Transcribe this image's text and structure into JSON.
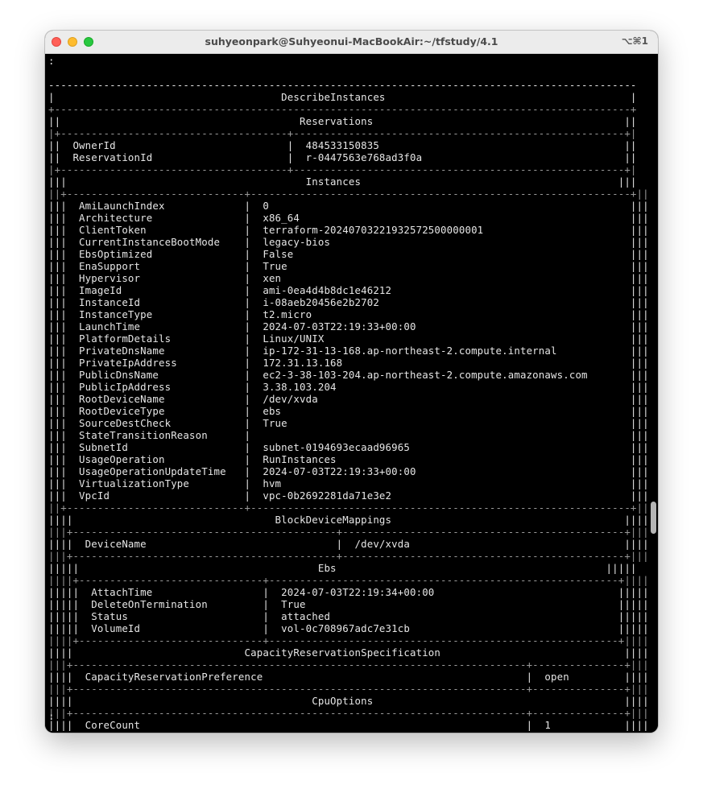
{
  "window": {
    "title": "suhyeonpark@Suhyeonui-MacBookAir:~/tfstudy/4.1",
    "shortcut": "⌥⌘1"
  },
  "terminal": {
    "lines": [
      ":",
      "",
      "------------------------------------------------------------------------------------------------",
      "|                                     DescribeInstances                                        |",
      "+----------------------------------------------------------------------------------------------+",
      "||                                       Reservations                                         ||",
      "|+-------------------------------------+------------------------------------------------------+|",
      "||  OwnerId                            |  484533150835                                        ||",
      "||  ReservationId                      |  r-0447563e768ad3f0a                                 ||",
      "|+-------------------------------------+------------------------------------------------------+|",
      "|||                                       Instances                                          |||",
      "||+-----------------------------+--------------------------------------------------------------+||",
      "|||  AmiLaunchIndex             |  0                                                           |||",
      "|||  Architecture               |  x86_64                                                      |||",
      "|||  ClientToken                |  terraform-20240703221932572500000001                        |||",
      "|||  CurrentInstanceBootMode    |  legacy-bios                                                 |||",
      "|||  EbsOptimized               |  False                                                       |||",
      "|||  EnaSupport                 |  True                                                        |||",
      "|||  Hypervisor                 |  xen                                                         |||",
      "|||  ImageId                    |  ami-0ea4d4b8dc1e46212                                       |||",
      "|||  InstanceId                 |  i-08aeb20456e2b2702                                         |||",
      "|||  InstanceType               |  t2.micro                                                    |||",
      "|||  LaunchTime                 |  2024-07-03T22:19:33+00:00                                   |||",
      "|||  PlatformDetails            |  Linux/UNIX                                                  |||",
      "|||  PrivateDnsName             |  ip-172-31-13-168.ap-northeast-2.compute.internal            |||",
      "|||  PrivateIpAddress           |  172.31.13.168                                               |||",
      "|||  PublicDnsName              |  ec2-3-38-103-204.ap-northeast-2.compute.amazonaws.com       |||",
      "|||  PublicIpAddress            |  3.38.103.204                                                |||",
      "|||  RootDeviceName             |  /dev/xvda                                                   |||",
      "|||  RootDeviceType             |  ebs                                                         |||",
      "|||  SourceDestCheck            |  True                                                        |||",
      "|||  StateTransitionReason      |                                                              |||",
      "|||  SubnetId                   |  subnet-0194693ecaad96965                                    |||",
      "|||  UsageOperation             |  RunInstances                                                |||",
      "|||  UsageOperationUpdateTime   |  2024-07-03T22:19:33+00:00                                   |||",
      "|||  VirtualizationType         |  hvm                                                         |||",
      "|||  VpcId                      |  vpc-0b2692281da71e3e2                                       |||",
      "||+-----------------------------+--------------------------------------------------------------+||",
      "||||                                 BlockDeviceMappings                                      ||||",
      "|||+-------------------------------------------+----------------------------------------------+|||",
      "||||  DeviceName                               |  /dev/xvda                                   ||||",
      "|||+-------------------------------------------+----------------------------------------------+|||",
      "|||||                                       Ebs                                            |||||",
      "||||+------------------------------+---------------------------------------------------------+||||",
      "|||||  AttachTime                  |  2024-07-03T22:19:34+00:00                              |||||",
      "|||||  DeleteOnTermination         |  True                                                   |||||",
      "|||||  Status                      |  attached                                               |||||",
      "|||||  VolumeId                    |  vol-0c708967adc7e31cb                                  |||||",
      "||||+------------------------------+---------------------------------------------------------+||||",
      "||||                            CapacityReservationSpecification                              ||||",
      "|||+--------------------------------------------------------------------------+---------------+|||",
      "||||  CapacityReservationPreference                                           |  open         ||||",
      "|||+--------------------------------------------------------------------------+---------------+|||",
      "||||                                       CpuOptions                                         ||||",
      "|||+--------------------------------------------------------------------------+---------------+|||",
      "||||  CoreCount                                                               |  1            ||||",
      ":"
    ]
  }
}
